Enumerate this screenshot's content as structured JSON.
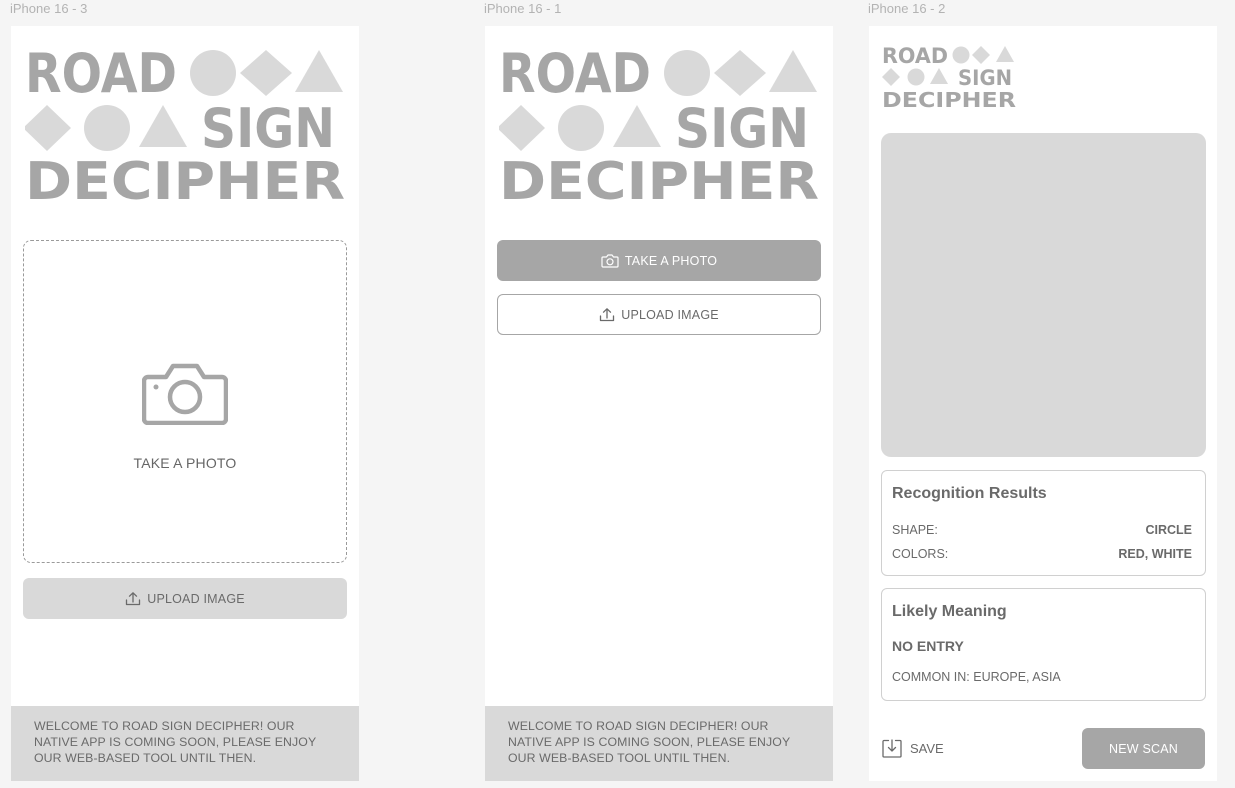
{
  "frames": {
    "f3": {
      "label": "iPhone 16 - 3",
      "take_photo": "TAKE A PHOTO",
      "upload": "UPLOAD IMAGE",
      "welcome": "WELCOME TO ROAD SIGN DECIPHER! OUR NATIVE APP IS COMING SOON, PLEASE ENJOY OUR WEB-BASED TOOL UNTIL THEN."
    },
    "f1": {
      "label": "iPhone 16 - 1",
      "take_photo": "TAKE A PHOTO",
      "upload": "UPLOAD IMAGE",
      "welcome": "WELCOME TO ROAD SIGN DECIPHER! OUR NATIVE APP IS COMING SOON, PLEASE ENJOY OUR WEB-BASED TOOL UNTIL THEN."
    },
    "f2": {
      "label": "iPhone 16 - 2",
      "results_title": "Recognition Results",
      "shape_label": "SHAPE:",
      "shape_value": "CIRCLE",
      "colors_label": "COLORS:",
      "colors_value": "RED, WHITE",
      "meaning_title": "Likely Meaning",
      "meaning_value": "NO ENTRY",
      "common_in": "COMMON IN: EUROPE, ASIA",
      "save": "SAVE",
      "new_scan": "NEW SCAN"
    }
  },
  "logo": {
    "word1": "ROAD",
    "word2": "SIGN",
    "word3": "DECIPHER"
  },
  "colors": {
    "logo_grey": "#a6a6a6",
    "shape_grey": "#d9d9d9",
    "footer_bg": "#d9d9d9",
    "button_dark": "#a6a6a6"
  },
  "icons": [
    "camera-icon",
    "upload-icon",
    "save-icon",
    "circle-shape",
    "diamond-shape",
    "triangle-shape"
  ]
}
